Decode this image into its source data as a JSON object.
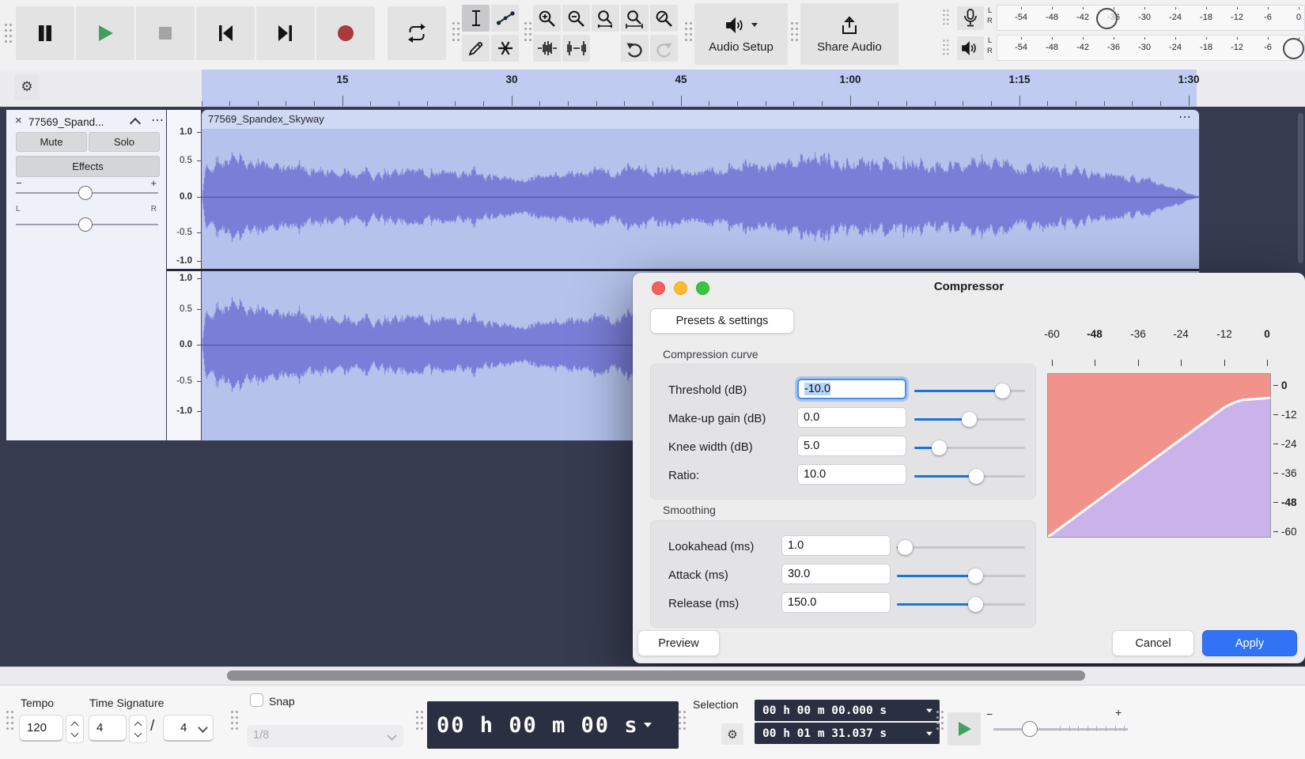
{
  "icons": {
    "gear": "⚙",
    "dots_menu": "⋯",
    "close": "×"
  },
  "toolbar": {
    "audio_setup_label": "Audio Setup",
    "share_audio_label": "Share Audio",
    "meters": {
      "left": "L",
      "right": "R",
      "scale": [
        "-54",
        "-48",
        "-42",
        "-36",
        "-30",
        "-24",
        "-18",
        "-12",
        "-6",
        "0"
      ]
    }
  },
  "timeline": {
    "labels": [
      "15",
      "30",
      "45",
      "1:00",
      "1:15",
      "1:30"
    ]
  },
  "track_panel": {
    "name": "77569_Spand...",
    "mute": "Mute",
    "solo": "Solo",
    "effects": "Effects",
    "gain_min": "−",
    "gain_max": "+",
    "pan_left": "L",
    "pan_right": "R"
  },
  "ruler_scale": [
    "1.0",
    "0.5",
    "0.0",
    "-0.5",
    "-1.0"
  ],
  "clip": {
    "title": "77569_Spandex_Skyway"
  },
  "compressor": {
    "title": "Compressor",
    "presets_button": "Presets & settings",
    "curve_section": "Compression curve",
    "smoothing_section": "Smoothing",
    "rows": {
      "threshold": {
        "label": "Threshold (dB)",
        "value": "-10.0"
      },
      "makeup": {
        "label": "Make-up gain (dB)",
        "value": "0.0"
      },
      "knee": {
        "label": "Knee width (dB)",
        "value": "5.0"
      },
      "ratio": {
        "label": "Ratio:",
        "value": "10.0"
      },
      "lookahead": {
        "label": "Lookahead (ms)",
        "value": "1.0"
      },
      "attack": {
        "label": "Attack (ms)",
        "value": "30.0"
      },
      "release": {
        "label": "Release (ms)",
        "value": "150.0"
      }
    },
    "buttons": {
      "preview": "Preview",
      "cancel": "Cancel",
      "apply": "Apply"
    },
    "graph": {
      "top_labels": [
        "-60",
        "-48",
        "-36",
        "-24",
        "-12",
        "0"
      ],
      "right_labels": [
        "0",
        "-12",
        "-24",
        "-36",
        "-48",
        "-60"
      ],
      "curve_points_in_out_db": [
        [
          -60,
          -60
        ],
        [
          -12.5,
          -12.5
        ],
        [
          -7.5,
          -9.75
        ],
        [
          0,
          -9
        ]
      ]
    }
  },
  "bottom": {
    "tempo_label": "Tempo",
    "tempo_value": "120",
    "time_signature_label": "Time Signature",
    "ts_upper": "4",
    "ts_slash": "/",
    "ts_lower": "4",
    "snap_label": "Snap",
    "snap_checked": false,
    "snap_value": "1/8",
    "time_display": "00 h 00 m 00 s",
    "selection_label": "Selection",
    "selection_start": "00 h 00 m 00.000 s",
    "selection_end": "00 h 01 m 31.037 s",
    "speed_minus": "−",
    "speed_plus": "+"
  },
  "colors": {
    "accent_blue": "#3273f5",
    "slider_blue": "#1774e0",
    "waveform": "#7a7ed7",
    "wave_bg": "#b5c3ec",
    "ruler_selection": "#bfcbf0",
    "dark_panel": "#363b4f",
    "display_bg": "#2b2f42",
    "graph_above": "#f2938b",
    "graph_below": "#cab3ea",
    "play_green": "#42a05f",
    "record_red": "#a93b3c"
  }
}
